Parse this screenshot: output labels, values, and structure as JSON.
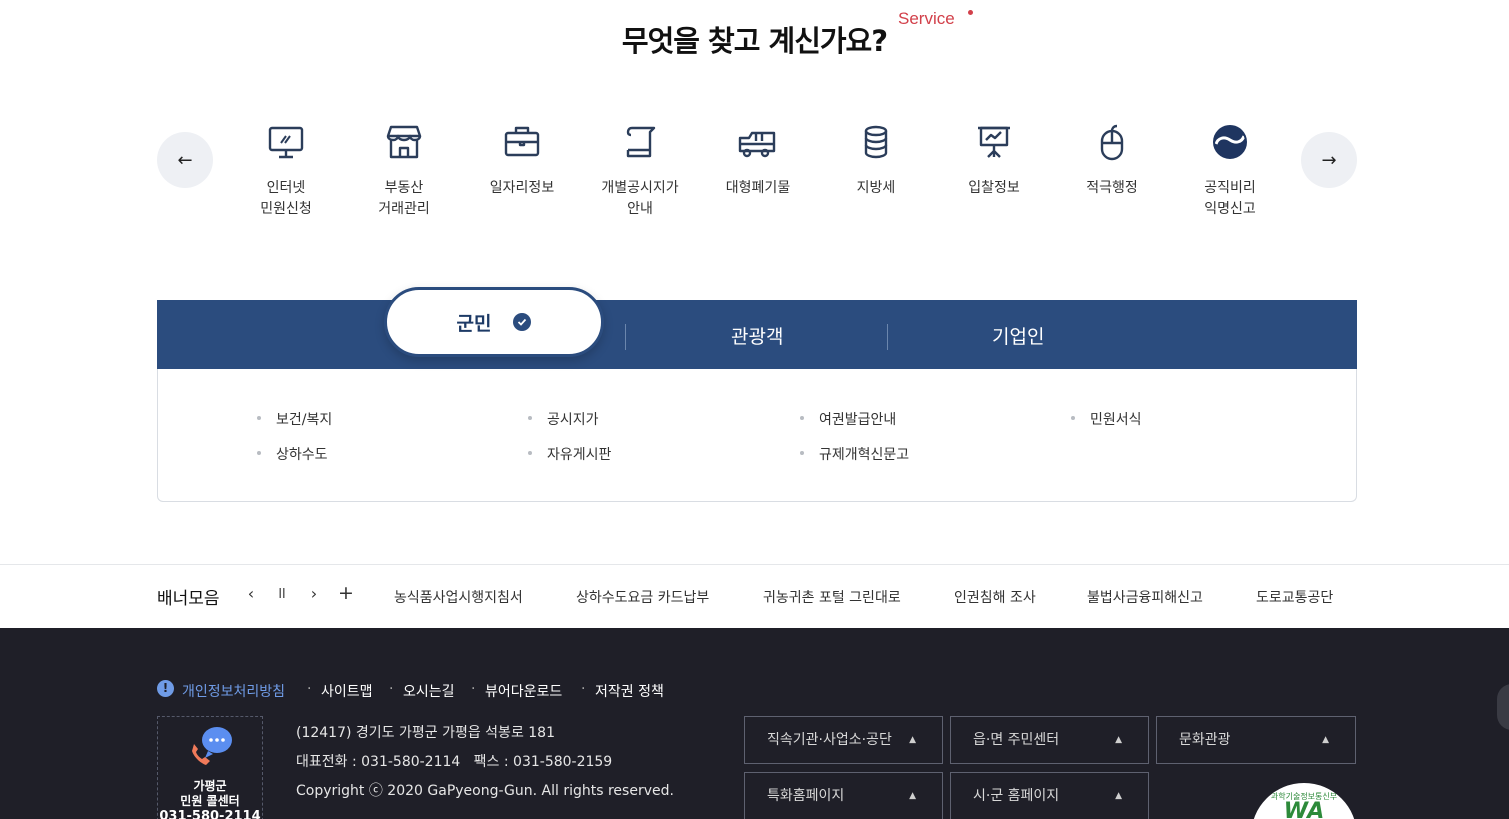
{
  "service": {
    "title": "무엇을 찾고 계신가요?",
    "tag": "Service",
    "prev_label": "←",
    "next_label": "→",
    "items": [
      {
        "label": "인터넷\n민원신청",
        "icon": "monitor-icon"
      },
      {
        "label": "부동산\n거래관리",
        "icon": "store-icon"
      },
      {
        "label": "일자리정보",
        "icon": "briefcase-icon"
      },
      {
        "label": "개별공시지가\n안내",
        "icon": "document-scroll-icon"
      },
      {
        "label": "대형폐기물",
        "icon": "truck-icon"
      },
      {
        "label": "지방세",
        "icon": "coin-stack-icon"
      },
      {
        "label": "입찰정보",
        "icon": "presentation-board-icon"
      },
      {
        "label": "적극행정",
        "icon": "mouse-icon"
      },
      {
        "label": "공직비리\n익명신고",
        "icon": "taegeuk-icon"
      }
    ]
  },
  "tabs": {
    "active": "군민",
    "others": [
      "관광객",
      "기업인"
    ],
    "links": [
      [
        "보건/복지",
        "상하수도"
      ],
      [
        "공시지가",
        "자유게시판"
      ],
      [
        "여권발급안내",
        "규제개혁신문고"
      ],
      [
        "민원서식"
      ]
    ]
  },
  "banner": {
    "title": "배너모음",
    "controls": {
      "prev": "‹",
      "pause": "ll",
      "next": "›",
      "more": "+"
    },
    "items": [
      "농식품사업시행지침서",
      "상하수도요금 카드납부",
      "귀농귀촌 포털 그린대로",
      "인권침해 조사",
      "불법사금융피해신고",
      "도로교통공단"
    ]
  },
  "footer": {
    "links": [
      "개인정보처리방침",
      "사이트맵",
      "오시는길",
      "뷰어다운로드",
      "저작권 정책"
    ],
    "callcenter": {
      "name": "가평군\n민원 콜센터",
      "phone": "031-580-2114"
    },
    "address": "(12417) 경기도 가평군 가평읍 석봉로 181",
    "contact": "대표전화 : 031-580-2114   팩스 : 031-580-2159",
    "copyright": "Copyright ⓒ 2020 GaPyeong-Gun. All rights reserved.",
    "selects": [
      "직속기관·사업소·공단",
      "읍·면 주민센터",
      "문화관광",
      "특화홈페이지",
      "시·군 홈페이지"
    ],
    "wa_mark": {
      "top": "과학기술정보통신부",
      "text": "WA"
    }
  },
  "colors": {
    "primary": "#2b4c7e",
    "accent": "#d2404a",
    "footer": "#1f1f28",
    "link": "#6f9be6"
  }
}
